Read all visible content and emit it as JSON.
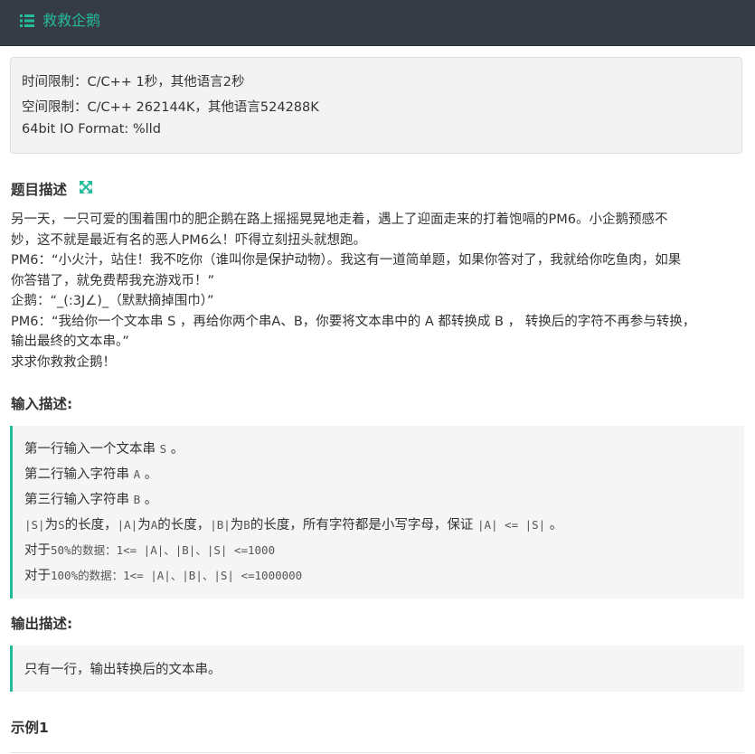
{
  "header": {
    "title": "救救企鹅",
    "icon": "list-icon",
    "accent": "#25bb9b"
  },
  "limits": {
    "time": "时间限制：C/C++ 1秒，其他语言2秒",
    "space": "空间限制：C/C++ 262144K，其他语言524288K",
    "format": "64bit IO Format: %lld"
  },
  "description": {
    "heading": "题目描述",
    "lines": [
      "另一天，一只可爱的围着围巾的肥企鹅在路上摇摇晃晃地走着，遇上了迎面走来的打着饱嗝的PM6。小企鹅预感不",
      "妙，这不就是最近有名的恶人PM6么！吓得立刻扭头就想跑。",
      "PM6：“小火汁，站住！我不吃你（谁叫你是保护动物）。我这有一道简单题，如果你答对了，我就给你吃鱼肉，如果",
      "你答错了，就免费帮我充游戏币！”",
      "企鹅：“_(:3J∠)_（默默摘掉围巾）”",
      "PM6：“我给你一个文本串 S ，再给你两个串A、B，你要将文本串中的 A 都转换成 B ， 转换后的字符不再参与转换，",
      "输出最终的文本串。”",
      "求求你救救企鹅！"
    ]
  },
  "input": {
    "heading": "输入描述:",
    "l1": {
      "a": "第一行输入一个文本串 ",
      "code": "S",
      "b": " 。"
    },
    "l2": {
      "a": "第二行输入字符串 ",
      "code": "A",
      "b": " 。"
    },
    "l3": {
      "a": "第三行输入字符串 ",
      "code": "B",
      "b": " 。"
    },
    "l4": {
      "c1": "|S|",
      "t1": "为",
      "c2": "S",
      "t2": "的长度，",
      "c3": "|A|",
      "t3": "为",
      "c4": "A",
      "t4": "的长度，",
      "c5": "|B|",
      "t5": "为",
      "c6": "B",
      "t6": "的长度，所有字符都是小写字母，保证 ",
      "c7": "|A| <= |S|",
      "t7": " 。"
    },
    "l5": {
      "a": "对于",
      "code": "50%的数据：1<= |A|、|B|、|S| <=1000"
    },
    "l6": {
      "a": "对于",
      "code": "100%的数据：1<= |A|、|B|、|S| <=1000000"
    }
  },
  "output": {
    "heading": "输出描述:",
    "text": "只有一行，输出转换后的文本串。"
  },
  "example": {
    "heading": "示例1"
  }
}
